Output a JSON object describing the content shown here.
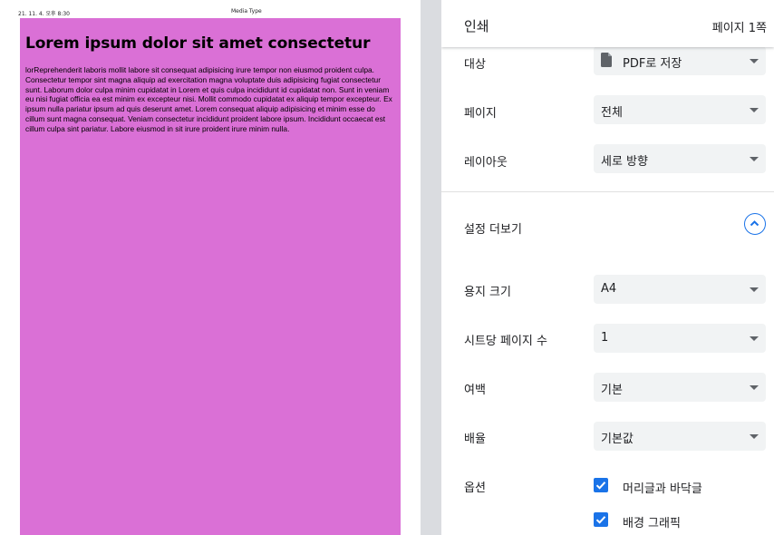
{
  "preview": {
    "header_date": "21. 11. 4. 오후 8:30",
    "header_title": "Media Type",
    "heading": "Lorem ipsum dolor sit amet consectetur",
    "body": "lorReprehenderit laboris mollit labore sit consequat adipisicing irure tempor non eiusmod proident culpa. Consectetur tempor sint magna aliquip ad exercitation magna voluptate duis adipisicing fugiat consectetur sunt. Laborum dolor culpa minim cupidatat in Lorem et quis culpa incididunt id cupidatat non. Sunt in veniam eu nisi fugiat officia ea est minim ex excepteur nisi. Mollit commodo cupidatat ex aliquip tempor excepteur. Ex ipsum nulla pariatur ipsum ad quis deserunt amet. Lorem consequat aliquip adipisicing et minim esse do cillum sunt magna consequat. Veniam consectetur incididunt proident labore ipsum. Incididunt occaecat est cillum culpa sint pariatur. Labore eiusmod in sit irure proident irure minim nulla.",
    "background_color": "#da70d6"
  },
  "panel": {
    "title": "인쇄",
    "page_count": "페이지 1쪽",
    "destination": {
      "label": "대상",
      "value": "PDF로 저장",
      "icon": "file-icon"
    },
    "pages": {
      "label": "페이지",
      "value": "전체"
    },
    "layout": {
      "label": "레이아웃",
      "value": "세로 방향"
    },
    "more_settings": {
      "label": "설정 더보기",
      "icon": "chevron-up-icon"
    },
    "paper_size": {
      "label": "용지 크기",
      "value": "A4"
    },
    "pages_per_sheet": {
      "label": "시트당 페이지 수",
      "value": "1"
    },
    "margins": {
      "label": "여백",
      "value": "기본"
    },
    "scale": {
      "label": "배율",
      "value": "기본값"
    },
    "options": {
      "label": "옵션",
      "headers_footers": {
        "label": "머리글과 바닥글",
        "checked": true
      },
      "background_graphics": {
        "label": "배경 그래픽",
        "checked": true
      }
    },
    "accent_color": "#1a73e8"
  }
}
